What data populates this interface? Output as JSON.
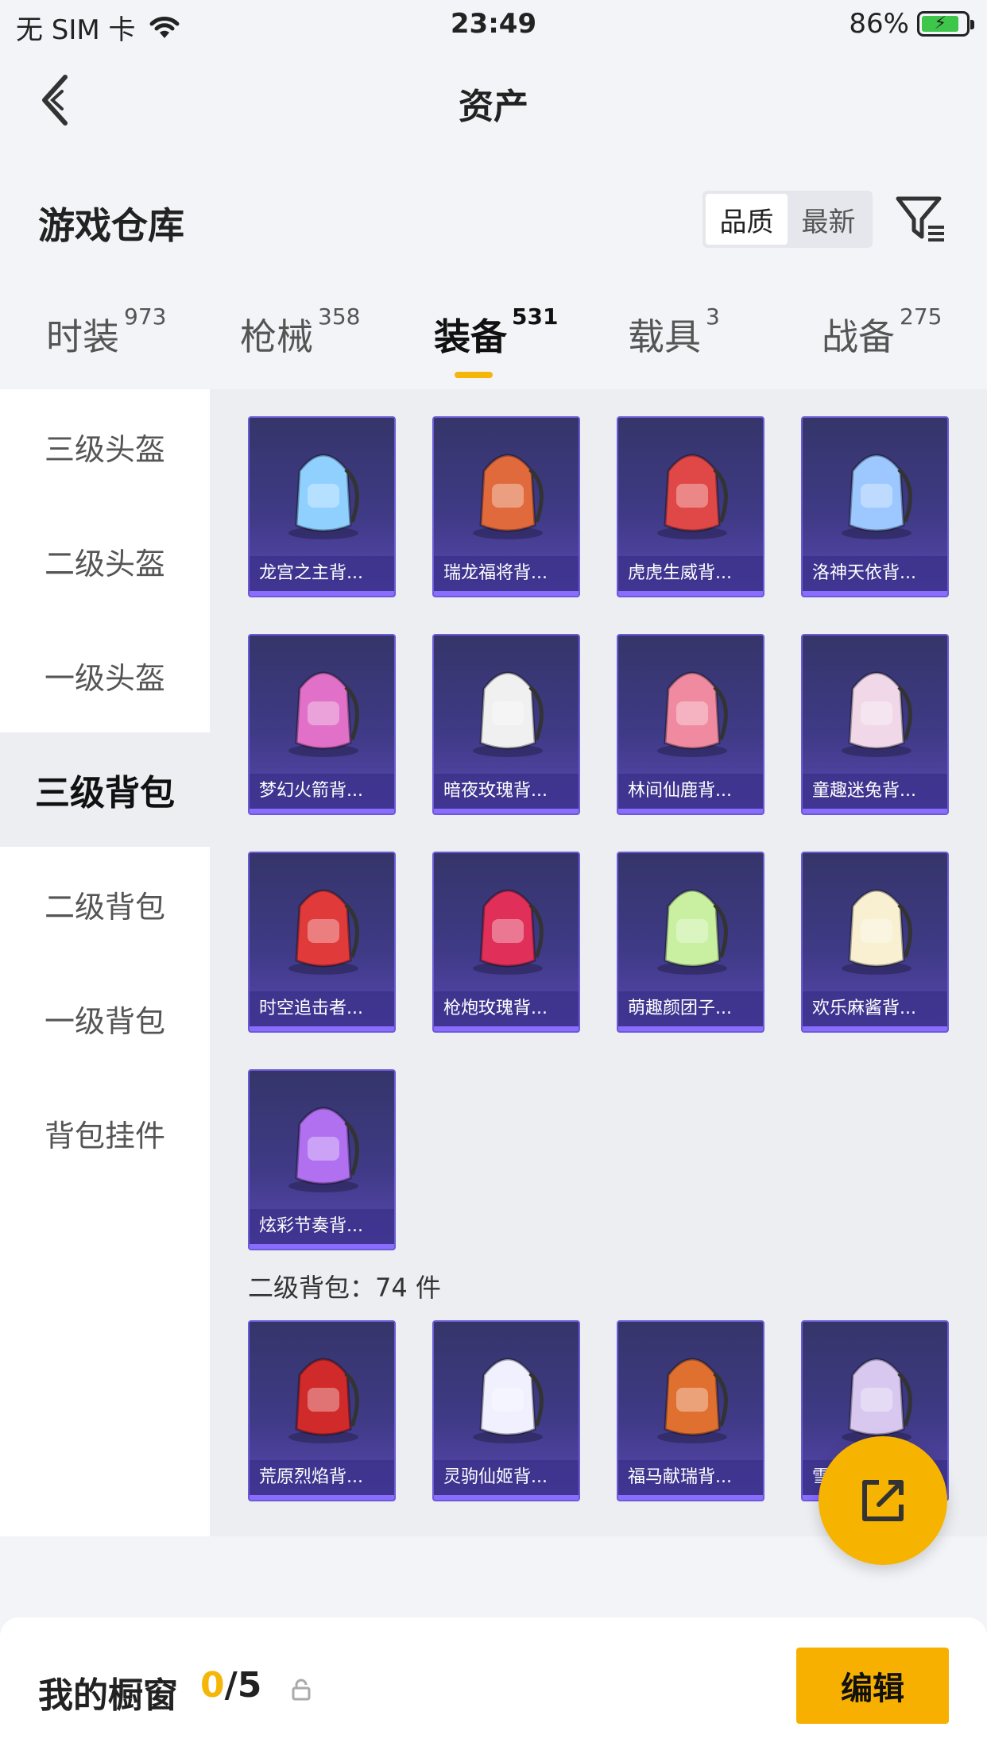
{
  "status_bar": {
    "carrier": "无 SIM 卡",
    "time": "23:49",
    "battery": "86%"
  },
  "nav": {
    "title": "资产"
  },
  "warehouse": {
    "title": "游戏仓库",
    "sort_options": [
      "品质",
      "最新"
    ],
    "active_sort": "品质"
  },
  "tabs": [
    {
      "label": "时装",
      "count": "973"
    },
    {
      "label": "枪械",
      "count": "358"
    },
    {
      "label": "装备",
      "count": "531"
    },
    {
      "label": "载具",
      "count": "3"
    },
    {
      "label": "战备",
      "count": "275"
    }
  ],
  "active_tab": "装备",
  "sidebar": [
    {
      "label": "三级头盔"
    },
    {
      "label": "二级头盔"
    },
    {
      "label": "一级头盔"
    },
    {
      "label": "三级背包"
    },
    {
      "label": "二级背包"
    },
    {
      "label": "一级背包"
    },
    {
      "label": "背包挂件"
    }
  ],
  "active_sidebar": "三级背包",
  "items_level3": [
    {
      "name": "龙宫之主背...",
      "icon": "blue-gold-staff-backpack-icon"
    },
    {
      "name": "瑞龙福将背...",
      "icon": "red-dragon-armor-backpack-icon"
    },
    {
      "name": "虎虎生威背...",
      "icon": "red-tiger-backpack-icon"
    },
    {
      "name": "洛神天依背...",
      "icon": "blue-white-ribbon-backpack-icon"
    },
    {
      "name": "梦幻火箭背...",
      "icon": "pink-rocket-backpack-icon"
    },
    {
      "name": "暗夜玫瑰背...",
      "icon": "white-rabbit-doll-backpack-icon"
    },
    {
      "name": "林间仙鹿背...",
      "icon": "pink-deer-backpack-icon"
    },
    {
      "name": "童趣迷兔背...",
      "icon": "checkered-rabbit-backpack-icon"
    },
    {
      "name": "时空追击者...",
      "icon": "red-hero-backpack-icon"
    },
    {
      "name": "枪炮玫瑰背...",
      "icon": "red-rose-backpack-icon"
    },
    {
      "name": "萌趣颜团子...",
      "icon": "green-dumpling-backpack-icon"
    },
    {
      "name": "欢乐麻酱背...",
      "icon": "mahjong-tile-backpack-icon"
    },
    {
      "name": "炫彩节奏背...",
      "icon": "purple-graffiti-backpack-icon"
    }
  ],
  "section_level2": {
    "label": "二级背包：74 件"
  },
  "items_level2": [
    {
      "name": "荒原烈焰背...",
      "icon": "red-black-flame-backpack-icon"
    },
    {
      "name": "灵驹仙姬背...",
      "icon": "white-moon-mirror-backpack-icon"
    },
    {
      "name": "福马献瑞背...",
      "icon": "orange-horse-backpack-icon"
    },
    {
      "name": "雪...",
      "icon": "snowman-purple-backpack-icon"
    }
  ],
  "bottom": {
    "showcase_title": "我的橱窗",
    "showcase_current": "0",
    "showcase_total": "/5",
    "edit_label": "编辑"
  },
  "colors": {
    "accent": "#f5b60a",
    "card_bg": "#3f3a86",
    "page_bg": "#f3f4f8"
  }
}
